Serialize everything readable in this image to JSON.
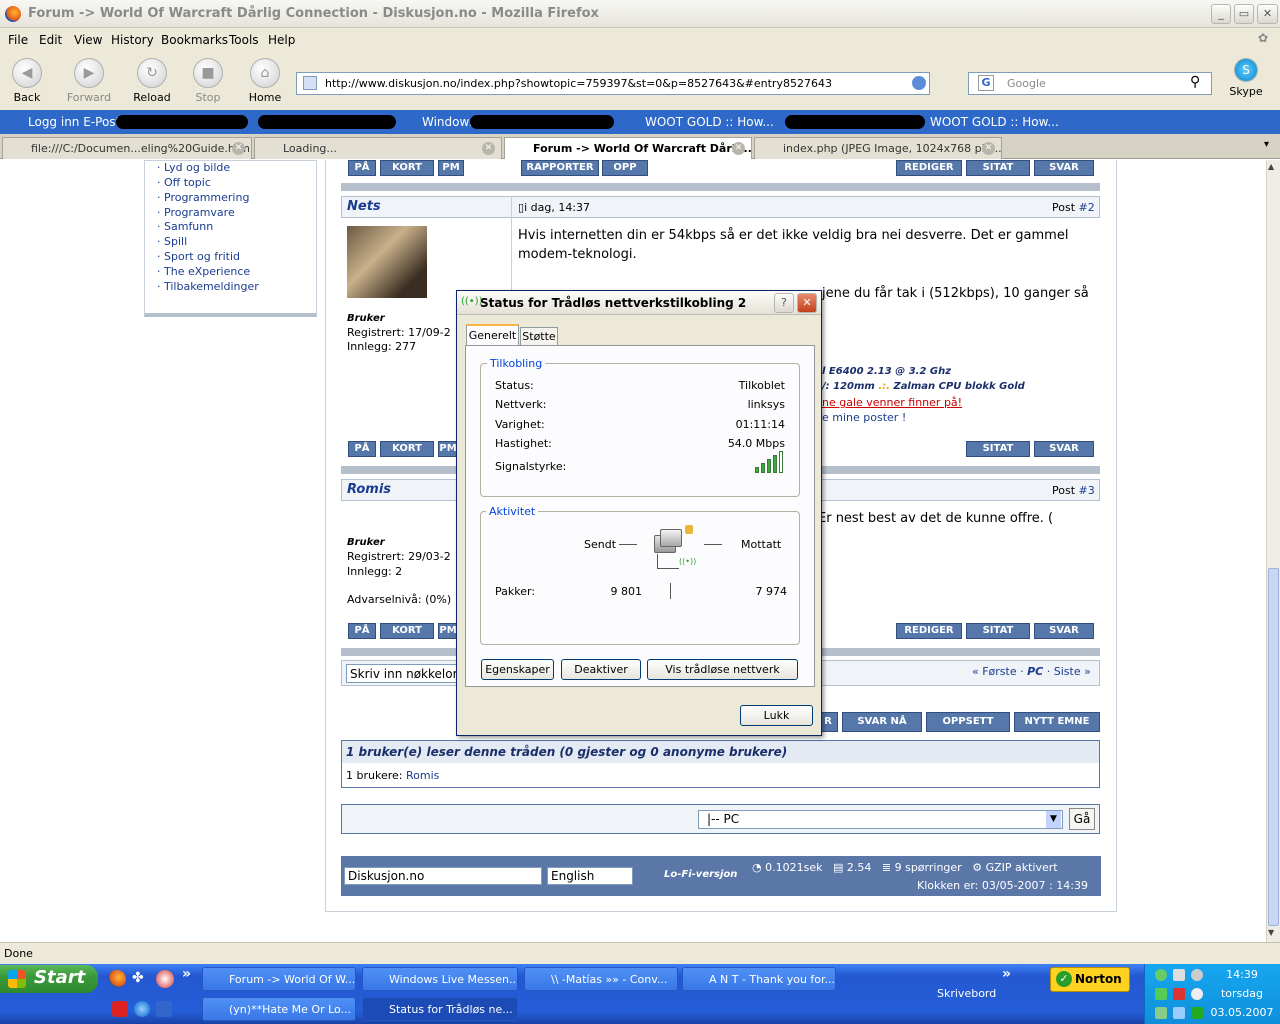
{
  "window": {
    "title": "Forum -> World Of Warcraft Dårlig Connection - Diskusjon.no - Mozilla Firefox",
    "controls": [
      "minimize",
      "maximize",
      "close"
    ]
  },
  "menu": [
    "File",
    "Edit",
    "View",
    "History",
    "Bookmarks",
    "Tools",
    "Help"
  ],
  "nav": {
    "back": "Back",
    "forward": "Forward",
    "reload": "Reload",
    "stop": "Stop",
    "home": "Home",
    "url": "http://www.diskusjon.no/index.php?showtopic=759397&st=0&p=8527643&#entry8527643",
    "search_placeholder": "Google",
    "skype": "Skype"
  },
  "bookmarks": [
    "Logg inn E-Post",
    "Windows",
    "WOOT GOLD :: How...",
    "WOOT GOLD :: How..."
  ],
  "tabs": [
    {
      "label": "file:///C:/Documen...eling%20Guide.htm"
    },
    {
      "label": "Loading..."
    },
    {
      "label": "Forum -> World Of Warcraft Dårli..."
    },
    {
      "label": "index.php (JPEG Image, 1024x768 pix..."
    }
  ],
  "sidebar": [
    "Lyd og bilde",
    "Off topic",
    "Programmering",
    "Programvare",
    "Samfunn",
    "Spill",
    "Sport og fritid",
    "The eXperience",
    "Tilbakemeldinger"
  ],
  "post_buttons": {
    "pa": "PÅ",
    "kort": "KORT",
    "pm": "PM",
    "rapporter": "RAPPORTER",
    "opp": "OPP",
    "rediger": "REDIGER",
    "sitat": "SITAT",
    "svar": "SVAR"
  },
  "posts": [
    {
      "author": "Nets",
      "time": "i dag, 14:37",
      "post_label": "Post",
      "post_no": "#2",
      "role": "Bruker",
      "registered": "Registrert: 17/09-2",
      "count": "Innlegg: 277",
      "body1": "Hvis internetten din er 54kbps så er det ikke veldig bra nei desverre. Det er gammel modem-teknologi.",
      "body2": "jene du får tak i (512kbps), 10 ganger så",
      "sig1": "l E6400 2.13 @ 3.2 Ghz",
      "sig2a": "/: 120mm",
      "sig2b": ".:.",
      "sig2c": "Zalman CPU blokk Gold",
      "sig3": "ne gale venner finner på!",
      "sig4": "e mine poster !"
    },
    {
      "author": "Romis",
      "post_label": "Post",
      "post_no": "#3",
      "role": "Bruker",
      "registered": "Registrert: 29/03-2",
      "count": "Innlegg: 2",
      "warn": "Advarselnivå: (0%)",
      "body1": "Er nest best av det de kunne offre. ("
    }
  ],
  "pagination": {
    "first": "« Første",
    "current": "PC",
    "last": "Siste »"
  },
  "search_box": "Skriv inn nøkkelor",
  "action_buttons": {
    "svar_partial": "R",
    "svar_na": "SVAR NÅ",
    "oppsett": "OPPSETT",
    "nytt_emne": "NYTT EMNE"
  },
  "readers": {
    "title": "1 bruker(e) leser denne tråden (0 gjester og 0 anonyme brukere)",
    "label": "1 brukere:",
    "user": "Romis"
  },
  "forum_jump": {
    "value": "|-- PC",
    "go": "Gå"
  },
  "footer": {
    "site": "Diskusjon.no",
    "lang": "English",
    "lofi": "Lo-Fi-versjon",
    "time": "0.1021sek",
    "load": "2.54",
    "queries": "9 spørringer",
    "gzip": "GZIP aktivert",
    "clock": "Klokken er: 03/05-2007 : 14:39"
  },
  "dialog": {
    "title": "Status for Trådløs nettverkstilkobling 2",
    "tabs": [
      "Generelt",
      "Støtte"
    ],
    "connection_group": "Tilkobling",
    "rows": [
      {
        "label": "Status:",
        "value": "Tilkoblet"
      },
      {
        "label": "Nettverk:",
        "value": "linksys"
      },
      {
        "label": "Varighet:",
        "value": "01:11:14"
      },
      {
        "label": "Hastighet:",
        "value": "54.0 Mbps"
      }
    ],
    "signal_label": "Signalstyrke:",
    "signal_bars_lit": 4,
    "signal_bars_total": 5,
    "activity_group": "Aktivitet",
    "sent": "Sendt",
    "received": "Mottatt",
    "packets_label": "Pakker:",
    "packets_sent": "9 801",
    "packets_received": "7 974",
    "buttons": [
      "Egenskaper",
      "Deaktiver",
      "Vis trådløse nettverk"
    ],
    "close": "Lukk"
  },
  "statusbar": "Done",
  "taskbar": {
    "start": "Start",
    "tasks": [
      {
        "label": "Forum -> World Of W...",
        "active": false
      },
      {
        "label": "Windows Live Messen...",
        "active": false
      },
      {
        "label": "\\\\ -Matías  »» - Conv...",
        "active": false
      },
      {
        "label": "A N T - Thank you for...",
        "active": false
      },
      {
        "label": "(yn)**Hate Me Or Lo...",
        "active": false
      },
      {
        "label": "Status for Trådløs ne...",
        "active": true
      }
    ],
    "toolbar_label": "Skrivebord",
    "norton": "Norton",
    "time": "14:39",
    "day": "torsdag",
    "date": "03.05.2007"
  },
  "colors": {
    "accent": "#5577aa",
    "link": "#1a3d8f",
    "taskbar": "#245ed8",
    "start": "#3a9a3a"
  }
}
